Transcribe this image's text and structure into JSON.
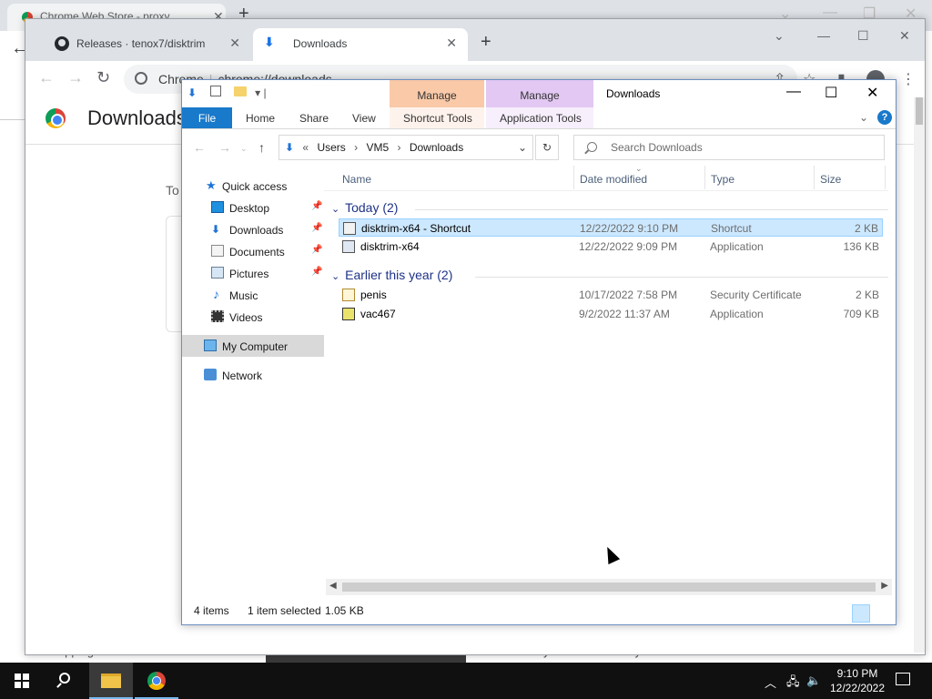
{
  "background_window": {
    "tab_title": "Chrome Web Store - proxy",
    "footer_left": "Shopping",
    "footer_right": "Unblock any website and stay secure with Touch VPN. On"
  },
  "chrome": {
    "tabs": [
      {
        "title": "Releases · tenox7/disktrim",
        "icon": "github-icon"
      },
      {
        "title": "Downloads",
        "icon": "download-icon"
      }
    ],
    "omnibox": {
      "scheme": "Chrome",
      "url": "chrome://downloads"
    },
    "page": {
      "title": "Downloads",
      "today_label": "To"
    }
  },
  "explorer": {
    "title": "Downloads",
    "qat_separator": "|",
    "contextual": [
      {
        "header": "Manage",
        "tab": "Shortcut Tools",
        "color": "#f9c9a8"
      },
      {
        "header": "Manage",
        "tab": "Application Tools",
        "color": "#e2c8f3"
      }
    ],
    "ribbon_tabs": [
      "File",
      "Home",
      "Share",
      "View"
    ],
    "breadcrumb": [
      "Users",
      "VM5",
      "Downloads"
    ],
    "breadcrumb_prefix": "«",
    "search_placeholder": "Search Downloads",
    "nav": {
      "quick_access": "Quick access",
      "pinned": [
        {
          "label": "Desktop",
          "icon": "desktop-icon"
        },
        {
          "label": "Downloads",
          "icon": "downloads-icon"
        },
        {
          "label": "Documents",
          "icon": "documents-icon"
        },
        {
          "label": "Pictures",
          "icon": "pictures-icon"
        }
      ],
      "others": [
        {
          "label": "Music",
          "icon": "music-icon"
        },
        {
          "label": "Videos",
          "icon": "videos-icon"
        }
      ],
      "my_computer": "My Computer",
      "network": "Network"
    },
    "columns": [
      "Name",
      "Date modified",
      "Type",
      "Size"
    ],
    "groups": [
      {
        "label": "Today (2)",
        "files": [
          {
            "name": "disktrim-x64 - Shortcut",
            "date": "12/22/2022 9:10 PM",
            "type": "Shortcut",
            "size": "2 KB",
            "selected": true,
            "icon": "shortcut-icon"
          },
          {
            "name": "disktrim-x64",
            "date": "12/22/2022 9:09 PM",
            "type": "Application",
            "size": "136 KB",
            "selected": false,
            "icon": "application-icon"
          }
        ]
      },
      {
        "label": "Earlier this year (2)",
        "files": [
          {
            "name": "penis",
            "date": "10/17/2022 7:58 PM",
            "type": "Security Certificate",
            "size": "2 KB",
            "selected": false,
            "icon": "certificate-icon"
          },
          {
            "name": "vac467",
            "date": "9/2/2022 11:37 AM",
            "type": "Application",
            "size": "709 KB",
            "selected": false,
            "icon": "application-icon"
          }
        ]
      }
    ],
    "status": {
      "items": "4 items",
      "selected": "1 item selected",
      "size": "1.05 KB"
    }
  },
  "taskbar": {
    "time": "9:10 PM",
    "date": "12/22/2022",
    "apps": [
      "file-explorer-icon",
      "chrome-icon"
    ]
  }
}
